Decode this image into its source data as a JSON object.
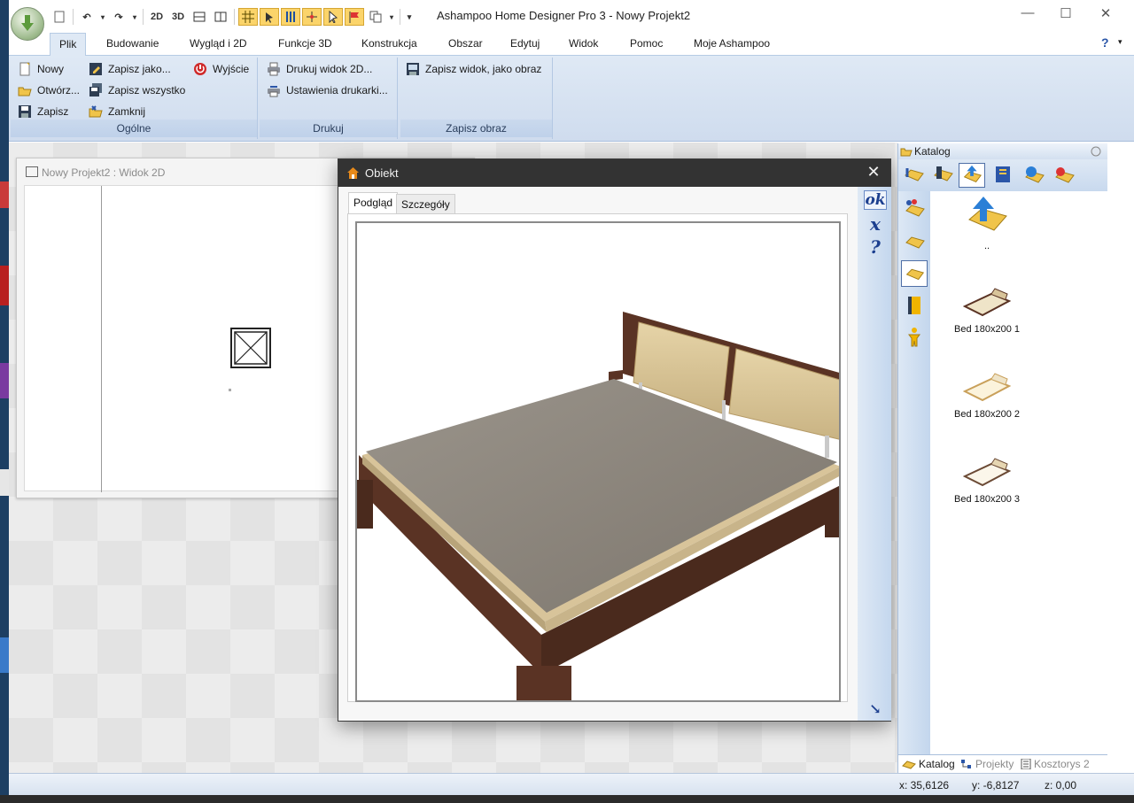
{
  "window": {
    "title": "Ashampoo Home Designer Pro 3 - Nowy Projekt2",
    "minimize": "—",
    "maximize": "☐",
    "close": "✕"
  },
  "quick_access": {
    "view_2d": "2D",
    "view_3d": "3D",
    "icons": [
      "new-document-icon",
      "undo-icon",
      "redo-icon",
      "2d-view-icon",
      "3d-view-icon",
      "split-horizontal-icon",
      "split-vertical-icon",
      "grid-icon",
      "pointer-grid-icon",
      "columns-icon",
      "snap-icon",
      "cursor-icon",
      "flag-icon",
      "copy-icon",
      "customize-icon"
    ]
  },
  "ribbon": {
    "tabs": [
      {
        "label": "Plik",
        "active": true
      },
      {
        "label": "Budowanie"
      },
      {
        "label": "Wygląd i 2D"
      },
      {
        "label": "Funkcje 3D"
      },
      {
        "label": "Konstrukcja"
      },
      {
        "label": "Obszar"
      },
      {
        "label": "Edytuj"
      },
      {
        "label": "Widok"
      },
      {
        "label": "Pomoc"
      },
      {
        "label": "Moje Ashampoo"
      }
    ],
    "help_label": "?",
    "groups": {
      "ogolne": {
        "label": "Ogólne",
        "new": "Nowy",
        "open": "Otwórz...",
        "save": "Zapisz",
        "save_as": "Zapisz jako...",
        "save_all": "Zapisz wszystko",
        "close": "Zamknij",
        "exit": "Wyjście"
      },
      "drukuj": {
        "label": "Drukuj",
        "print_2d": "Drukuj widok 2D...",
        "printer_settings": "Ustawienia drukarki..."
      },
      "zapisz_obraz": {
        "label": "Zapisz obraz",
        "save_view_image": "Zapisz widok, jako obraz"
      }
    }
  },
  "view2d": {
    "title": "Nowy Projekt2 : Widok 2D"
  },
  "dialog": {
    "title": "Obiekt",
    "close": "✕",
    "tabs": [
      {
        "label": "Podgląd",
        "active": true
      },
      {
        "label": "Szczegóły"
      }
    ],
    "side_buttons": {
      "ok": "ok",
      "cancel": "x",
      "help": "?"
    },
    "resize_icon": "↘"
  },
  "catalog": {
    "title": "Katalog",
    "up_item": "..",
    "items": [
      {
        "label": "Bed 180x200 1"
      },
      {
        "label": "Bed 180x200 2"
      },
      {
        "label": "Bed 180x200 3"
      }
    ],
    "bottom_tabs": [
      {
        "label": "Katalog",
        "active": true
      },
      {
        "label": "Projekty"
      },
      {
        "label": "Kosztorys 2"
      }
    ]
  },
  "status": {
    "x": "x: 35,6126",
    "y": "y: -6,8127",
    "z": "z: 0,00"
  },
  "colors": {
    "ribbon_bg": "#dfe9f5",
    "dialog_title_bg": "#333333",
    "highlight": "#fbd46a",
    "bed_frame": "#5a3324",
    "mattress": "#8e877d",
    "headboard_cushion": "#d8c49a"
  }
}
